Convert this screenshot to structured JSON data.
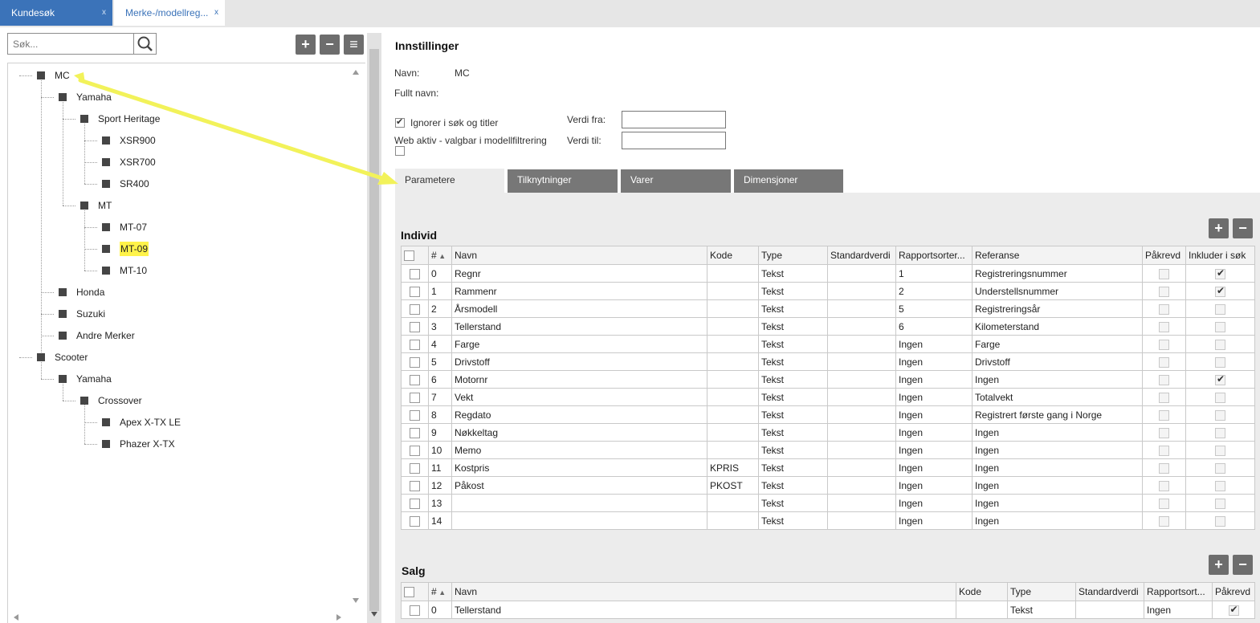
{
  "tabs": [
    {
      "label": "Kundesøk",
      "close": "x"
    },
    {
      "label": "Merke-/modellreg...",
      "close": "x"
    }
  ],
  "tree": {
    "search_placeholder": "Søk...",
    "add": "+",
    "remove": "−",
    "menu": "≡",
    "nodes": [
      {
        "label": "MC",
        "level": 0
      },
      {
        "label": "Yamaha",
        "level": 1
      },
      {
        "label": "Sport Heritage",
        "level": 2
      },
      {
        "label": "XSR900",
        "level": 3
      },
      {
        "label": "XSR700",
        "level": 3
      },
      {
        "label": "SR400",
        "level": 3
      },
      {
        "label": "MT",
        "level": 2
      },
      {
        "label": "MT-07",
        "level": 3
      },
      {
        "label": "MT-09",
        "level": 3,
        "highlighted": true
      },
      {
        "label": "MT-10",
        "level": 3
      },
      {
        "label": "Honda",
        "level": 1
      },
      {
        "label": "Suzuki",
        "level": 1
      },
      {
        "label": "Andre Merker",
        "level": 1
      },
      {
        "label": "Scooter",
        "level": 0
      },
      {
        "label": "Yamaha",
        "level": 1
      },
      {
        "label": "Crossover",
        "level": 2
      },
      {
        "label": "Apex X-TX LE",
        "level": 3
      },
      {
        "label": "Phazer X-TX",
        "level": 3
      }
    ]
  },
  "settings": {
    "title": "Innstillinger",
    "navn_label": "Navn:",
    "navn_value": "MC",
    "fullt_navn_label": "Fullt navn:",
    "ignore_label": "Ignorer i søk og titler",
    "ignore_checked": true,
    "web_label": "Web aktiv - valgbar i modellfiltrering",
    "web_checked": false,
    "verdi_fra_label": "Verdi fra:",
    "verdi_til_label": "Verdi til:",
    "verdi_fra_value": "",
    "verdi_til_value": ""
  },
  "detail_tabs": [
    "Parametere",
    "Tilknytninger",
    "Varer",
    "Dimensjoner"
  ],
  "individ": {
    "title": "Individ",
    "add": "+",
    "remove": "−",
    "columns": [
      "#",
      "Navn",
      "Kode",
      "Type",
      "Standardverdi",
      "Rapportsorter...",
      "Referanse",
      "Påkrevd",
      "Inkluder i søk"
    ],
    "rows": [
      {
        "n": "0",
        "navn": "Regnr",
        "kode": "",
        "type": "Tekst",
        "std": "",
        "rapp": "1",
        "ref": "Registreringsnummer",
        "pakrevd": false,
        "inkl": true
      },
      {
        "n": "1",
        "navn": "Rammenr",
        "kode": "",
        "type": "Tekst",
        "std": "",
        "rapp": "2",
        "ref": "Understellsnummer",
        "pakrevd": false,
        "inkl": true
      },
      {
        "n": "2",
        "navn": "Årsmodell",
        "kode": "",
        "type": "Tekst",
        "std": "",
        "rapp": "5",
        "ref": "Registreringsår",
        "pakrevd": false,
        "inkl": false
      },
      {
        "n": "3",
        "navn": "Tellerstand",
        "kode": "",
        "type": "Tekst",
        "std": "",
        "rapp": "6",
        "ref": "Kilometerstand",
        "pakrevd": false,
        "inkl": false
      },
      {
        "n": "4",
        "navn": "Farge",
        "kode": "",
        "type": "Tekst",
        "std": "",
        "rapp": "Ingen",
        "ref": "Farge",
        "pakrevd": false,
        "inkl": false
      },
      {
        "n": "5",
        "navn": "Drivstoff",
        "kode": "",
        "type": "Tekst",
        "std": "",
        "rapp": "Ingen",
        "ref": "Drivstoff",
        "pakrevd": false,
        "inkl": false
      },
      {
        "n": "6",
        "navn": "Motornr",
        "kode": "",
        "type": "Tekst",
        "std": "",
        "rapp": "Ingen",
        "ref": "Ingen",
        "pakrevd": false,
        "inkl": true
      },
      {
        "n": "7",
        "navn": "Vekt",
        "kode": "",
        "type": "Tekst",
        "std": "",
        "rapp": "Ingen",
        "ref": "Totalvekt",
        "pakrevd": false,
        "inkl": false
      },
      {
        "n": "8",
        "navn": "Regdato",
        "kode": "",
        "type": "Tekst",
        "std": "",
        "rapp": "Ingen",
        "ref": "Registrert første gang i Norge",
        "pakrevd": false,
        "inkl": false
      },
      {
        "n": "9",
        "navn": "Nøkkeltag",
        "kode": "",
        "type": "Tekst",
        "std": "",
        "rapp": "Ingen",
        "ref": "Ingen",
        "pakrevd": false,
        "inkl": false
      },
      {
        "n": "10",
        "navn": "Memo",
        "kode": "",
        "type": "Tekst",
        "std": "",
        "rapp": "Ingen",
        "ref": "Ingen",
        "pakrevd": false,
        "inkl": false
      },
      {
        "n": "11",
        "navn": "Kostpris",
        "kode": "KPRIS",
        "type": "Tekst",
        "std": "",
        "rapp": "Ingen",
        "ref": "Ingen",
        "pakrevd": false,
        "inkl": false
      },
      {
        "n": "12",
        "navn": "Påkost",
        "kode": "PKOST",
        "type": "Tekst",
        "std": "",
        "rapp": "Ingen",
        "ref": "Ingen",
        "pakrevd": false,
        "inkl": false
      },
      {
        "n": "13",
        "navn": "",
        "kode": "",
        "type": "Tekst",
        "std": "",
        "rapp": "Ingen",
        "ref": "Ingen",
        "pakrevd": false,
        "inkl": false
      },
      {
        "n": "14",
        "navn": "",
        "kode": "",
        "type": "Tekst",
        "std": "",
        "rapp": "Ingen",
        "ref": "Ingen",
        "pakrevd": false,
        "inkl": false
      }
    ]
  },
  "salg": {
    "title": "Salg",
    "add": "+",
    "remove": "−",
    "columns": [
      "#",
      "Navn",
      "Kode",
      "Type",
      "Standardverdi",
      "Rapportsort...",
      "Påkrevd"
    ],
    "rows": [
      {
        "n": "0",
        "navn": "Tellerstand",
        "kode": "",
        "type": "Tekst",
        "std": "",
        "rapp": "Ingen",
        "pakrevd": true
      }
    ]
  },
  "colors": {
    "accent": "#3b73b9",
    "annotation_arrow": "#f2f25a",
    "highlight": "#fff34a"
  }
}
